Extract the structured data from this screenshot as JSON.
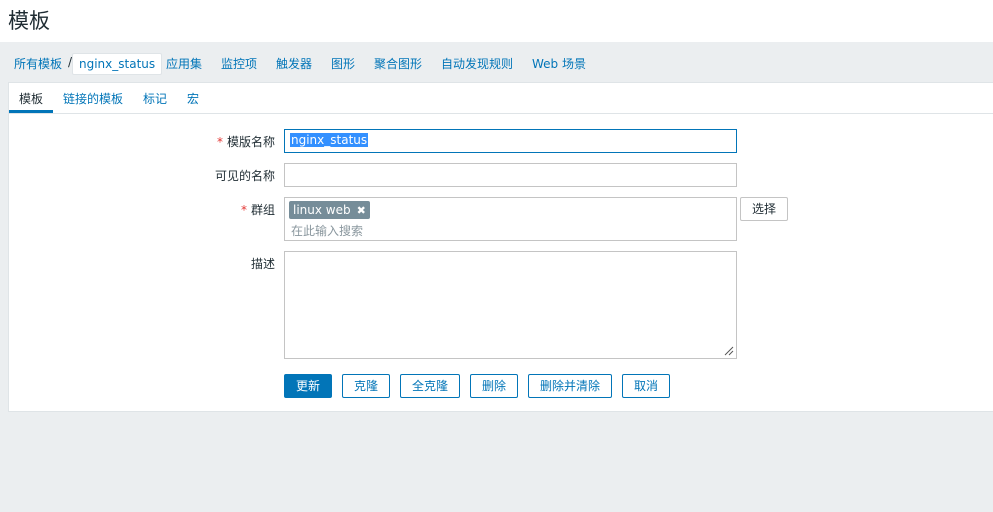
{
  "page": {
    "title": "模板"
  },
  "breadcrumb": {
    "root_label": "所有模板",
    "separator": "/",
    "current_label": "nginx_status"
  },
  "nav": {
    "items": [
      "应用集",
      "监控项",
      "触发器",
      "图形",
      "聚合图形",
      "自动发现规则",
      "Web 场景"
    ]
  },
  "tabs": [
    "模板",
    "链接的模板",
    "标记",
    "宏"
  ],
  "form": {
    "required_marker": "*",
    "template_name": {
      "label": "模版名称",
      "value": "nginx_status"
    },
    "visible_name": {
      "label": "可见的名称",
      "value": ""
    },
    "groups": {
      "label": "群组",
      "tag": "linux web",
      "tag_remove": "✖",
      "placeholder": "在此输入搜索",
      "select_button": "选择"
    },
    "description": {
      "label": "描述",
      "value": ""
    }
  },
  "buttons": {
    "update": "更新",
    "clone": "克隆",
    "full_clone": "全克隆",
    "delete": "删除",
    "delete_clear": "删除并清除",
    "cancel": "取消"
  },
  "colors": {
    "accent": "#0275b8",
    "required": "#e33734",
    "tag_bg": "#768d99",
    "background": "#ebeef0"
  }
}
